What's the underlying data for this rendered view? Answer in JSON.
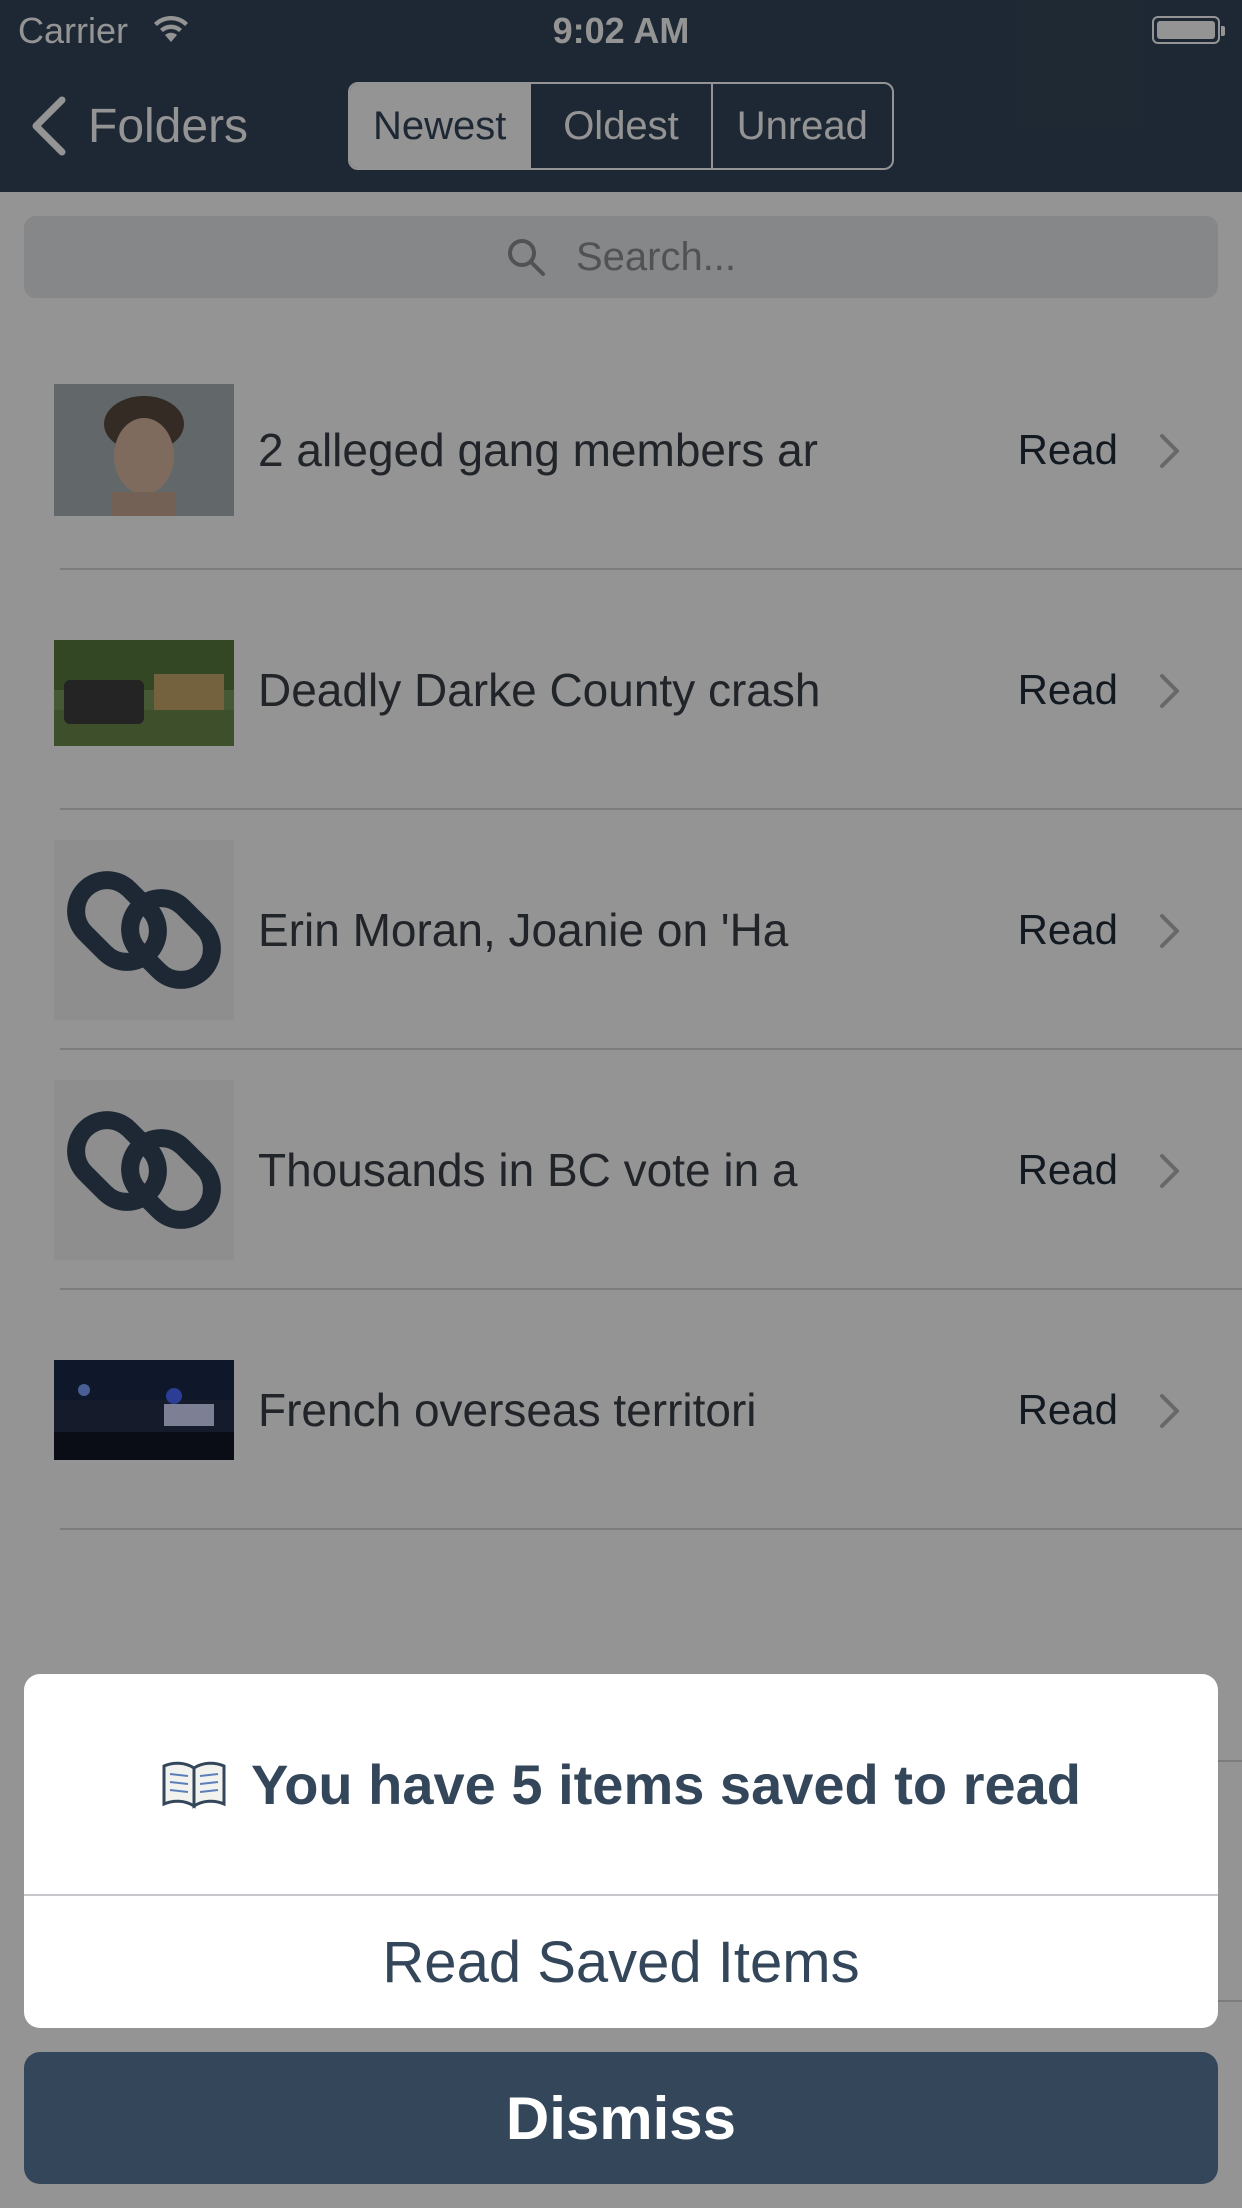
{
  "status_bar": {
    "carrier": "Carrier",
    "time": "9:02 AM"
  },
  "nav": {
    "back_label": "Folders",
    "segments": [
      "Newest",
      "Oldest",
      "Unread"
    ],
    "selected_segment": "Newest"
  },
  "search": {
    "placeholder": "Search..."
  },
  "items": [
    {
      "title": "2 alleged gang members ar",
      "action": "Read",
      "thumbnail": "photo-mugshot"
    },
    {
      "title": "Deadly Darke County crash",
      "action": "Read",
      "thumbnail": "photo-crash-scene"
    },
    {
      "title": "Erin Moran, Joanie on 'Ha",
      "action": "Read",
      "thumbnail": "link-icon"
    },
    {
      "title": "Thousands in BC vote in a",
      "action": "Read",
      "thumbnail": "link-icon"
    },
    {
      "title": "French overseas territori",
      "action": "Read",
      "thumbnail": "photo-night-street"
    }
  ],
  "action_sheet": {
    "title": "You have 5 items saved to read",
    "title_icon": "open-book-icon",
    "primary_action": "Read Saved Items",
    "cancel_action": "Dismiss"
  },
  "colors": {
    "nav_background": "#34465a",
    "accent": "#34465a",
    "row_text": "#3a3f47"
  }
}
